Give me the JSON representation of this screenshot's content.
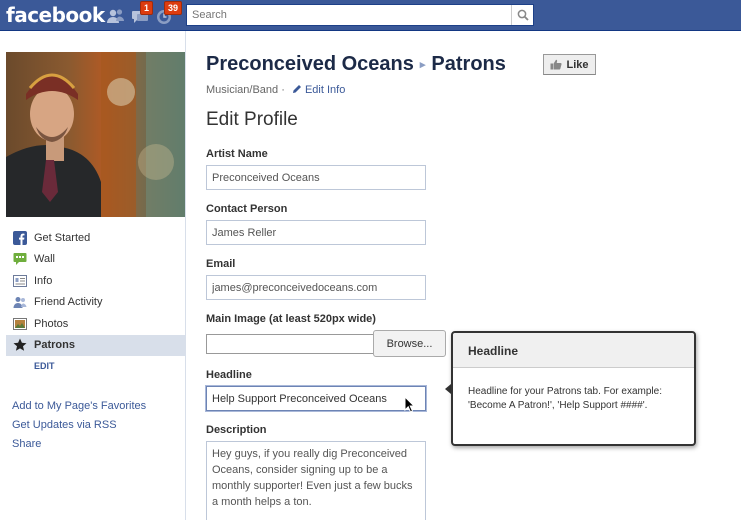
{
  "topbar": {
    "logo": "facebook",
    "jewels": [
      {
        "icon": "friend-requests-icon",
        "count": ""
      },
      {
        "icon": "messages-icon",
        "count": "1"
      },
      {
        "icon": "notifications-icon",
        "count": "39"
      }
    ],
    "search_placeholder": "Search"
  },
  "sidebar": {
    "items": [
      {
        "icon": "facebook-f-icon",
        "label": "Get Started"
      },
      {
        "icon": "wall-icon",
        "label": "Wall"
      },
      {
        "icon": "info-icon",
        "label": "Info"
      },
      {
        "icon": "friend-activity-icon",
        "label": "Friend Activity"
      },
      {
        "icon": "photos-icon",
        "label": "Photos"
      },
      {
        "icon": "star-icon",
        "label": "Patrons",
        "active": true
      }
    ],
    "edit_label": "EDIT",
    "links": [
      "Add to My Page's Favorites",
      "Get Updates via RSS",
      "Share"
    ]
  },
  "page": {
    "name": "Preconceived Oceans",
    "section": "Patrons",
    "like_label": "Like",
    "category": "Musician/Band",
    "category_sep": "·",
    "edit_info_label": "Edit Info",
    "heading": "Edit Profile"
  },
  "form": {
    "artist_name": {
      "label": "Artist Name",
      "value": "Preconceived Oceans"
    },
    "contact_person": {
      "label": "Contact Person",
      "value": "James Reller"
    },
    "email": {
      "label": "Email",
      "value": "james@preconceivedoceans.com"
    },
    "main_image": {
      "label": "Main Image (at least 520px wide)",
      "browse_label": "Browse..."
    },
    "headline": {
      "label": "Headline",
      "value": "Help Support Preconceived Oceans"
    },
    "description": {
      "label": "Description",
      "value": "Hey guys, if you really dig Preconceived Oceans, consider signing up to be a monthly supporter! Even just a few bucks a month helps a ton."
    }
  },
  "tooltip": {
    "title": "Headline",
    "body": "Headline for your Patrons tab. For example: 'Become A Patron!', 'Help Support ####'."
  },
  "colors": {
    "brand": "#3b5998",
    "badge": "#dd3c10",
    "active_nav": "#d8dfea"
  }
}
